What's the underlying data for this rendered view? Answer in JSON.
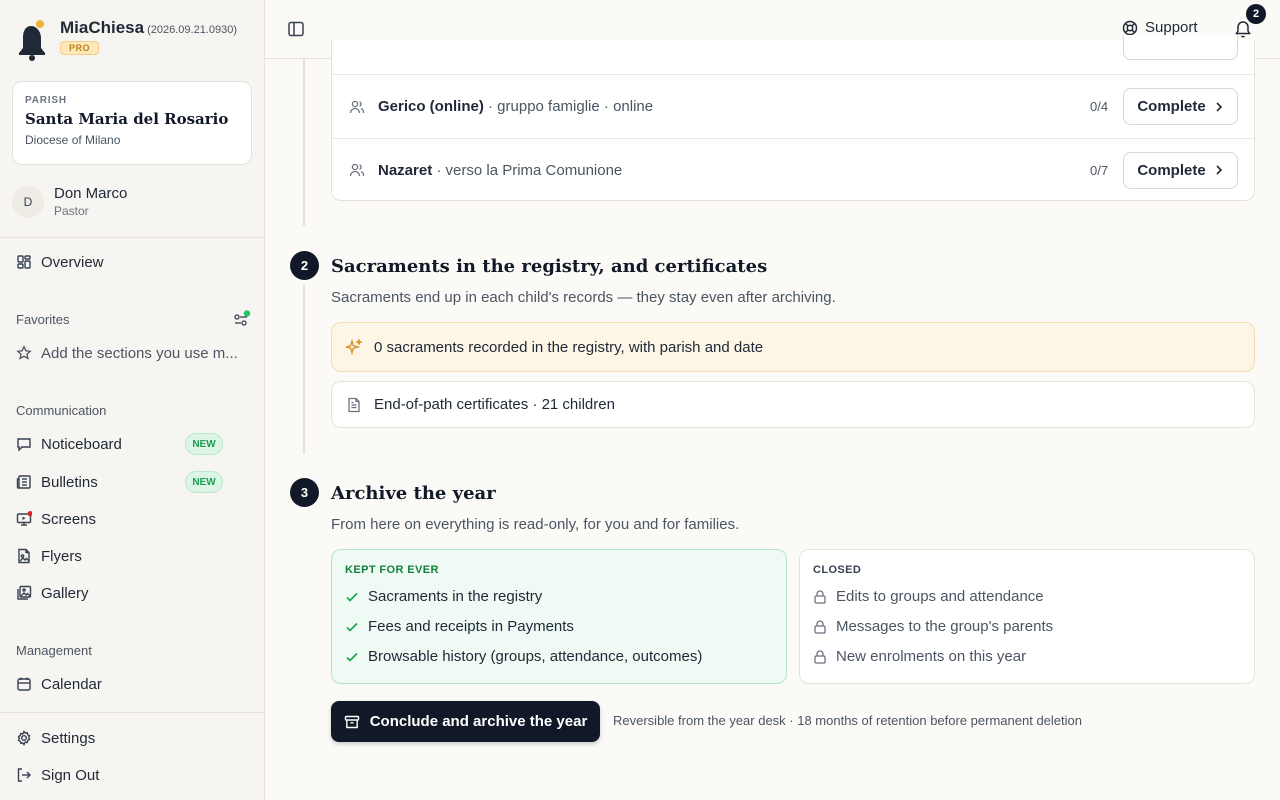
{
  "brand": {
    "name": "MiaChiesa",
    "version": "(2026.09.21.0930)",
    "tier": "PRO"
  },
  "parish": {
    "kicker": "PARISH",
    "name": "Santa Maria del Rosario",
    "diocese": "Diocese of Milano"
  },
  "user": {
    "initial": "D",
    "name": "Don Marco",
    "role": "Pastor"
  },
  "nav": {
    "overview": "Overview",
    "favorites_label": "Favorites",
    "favorites_hint": "Add the sections you use m...",
    "communication_label": "Communication",
    "noticeboard": "Noticeboard",
    "bulletins": "Bulletins",
    "new_badge": "NEW",
    "screens": "Screens",
    "flyers": "Flyers",
    "gallery": "Gallery",
    "management_label": "Management",
    "calendar": "Calendar",
    "settings": "Settings",
    "signout": "Sign Out"
  },
  "header": {
    "support": "Support",
    "notifications": "2"
  },
  "groups": [
    {
      "name": "Gerico (online)",
      "detail": " · gruppo famiglie · online",
      "count": "0/4",
      "action": "Complete"
    },
    {
      "name": "Nazaret",
      "detail": " · verso la Prima Comunione",
      "count": "0/7",
      "action": "Complete"
    }
  ],
  "step2": {
    "number": "2",
    "title": "Sacraments in the registry, and certificates",
    "desc": "Sacraments end up in each child's records — they stay even after archiving.",
    "sacraments": "0 sacraments recorded in the registry, with parish and date",
    "certificates": "End-of-path certificates · 21 children"
  },
  "step3": {
    "number": "3",
    "title": "Archive the year",
    "desc": "From here on everything is read-only, for you and for families.",
    "kept_head": "KEPT FOR EVER",
    "kept": [
      "Sacraments in the registry",
      "Fees and receipts in Payments",
      "Browsable history (groups, attendance, outcomes)"
    ],
    "closed_head": "CLOSED",
    "closed": [
      "Edits to groups and attendance",
      "Messages to the group's parents",
      "New enrolments on this year"
    ],
    "button": "Conclude and archive the year",
    "note": "Reversible from the year desk · 18 months of retention before permanent deletion"
  },
  "colors": {
    "accent": "#111827",
    "kept_green": "#15803d",
    "warn_bg": "#fdf5e6",
    "new_green": "#1f9d55",
    "alert_red": "#dc2626"
  }
}
